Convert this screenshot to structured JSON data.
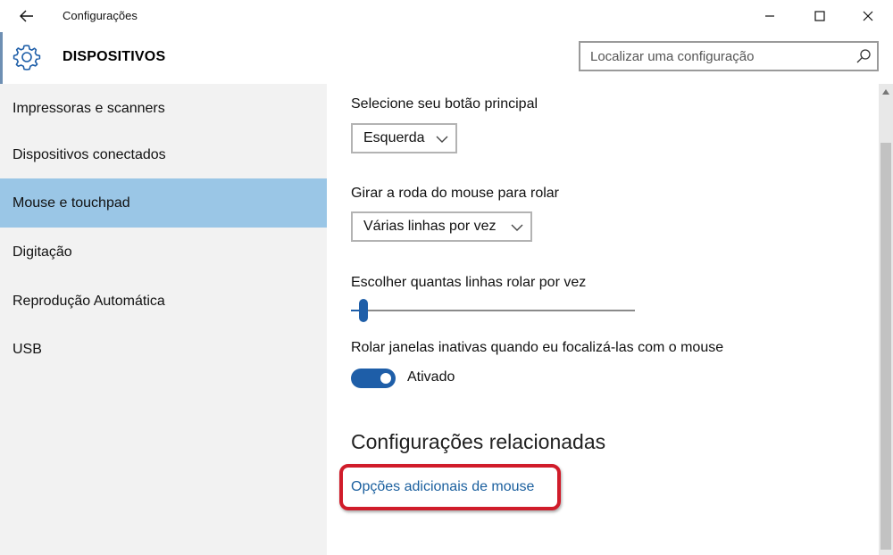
{
  "window": {
    "title": "Configurações"
  },
  "header": {
    "section_title": "DISPOSITIVOS",
    "search_placeholder": "Localizar uma configuração"
  },
  "sidebar": {
    "selected_index": 2,
    "items": [
      {
        "label": "Impressoras e scanners"
      },
      {
        "label": "Dispositivos conectados"
      },
      {
        "label": "Mouse e touchpad"
      },
      {
        "label": "Digitação"
      },
      {
        "label": "Reprodução Automática"
      },
      {
        "label": "USB"
      }
    ]
  },
  "main": {
    "primary_button": {
      "label": "Selecione seu botão principal",
      "value": "Esquerda"
    },
    "scroll_wheel": {
      "label": "Girar a roda do mouse para rolar",
      "value": "Várias linhas por vez"
    },
    "lines_slider": {
      "label": "Escolher quantas linhas rolar por vez",
      "level_percent": 3
    },
    "inactive_scroll": {
      "label": "Rolar janelas inativas quando eu focalizá-las com o mouse",
      "state_text": "Ativado",
      "on": true
    },
    "related": {
      "title": "Configurações relacionadas",
      "link_label": "Opções adicionais de mouse"
    }
  },
  "colors": {
    "accent": "#1e5ea8",
    "selected_nav": "#9ac6e6",
    "sidebar_bg": "#f2f2f2",
    "link": "#1a5f9e",
    "highlight": "#d01c2a"
  },
  "icons": {
    "back": "back-arrow-icon",
    "minimize": "minimize-icon",
    "maximize": "maximize-icon",
    "close": "close-icon",
    "section": "gear-icon",
    "search": "search-icon",
    "dropdown": "chevron-down-icon"
  }
}
